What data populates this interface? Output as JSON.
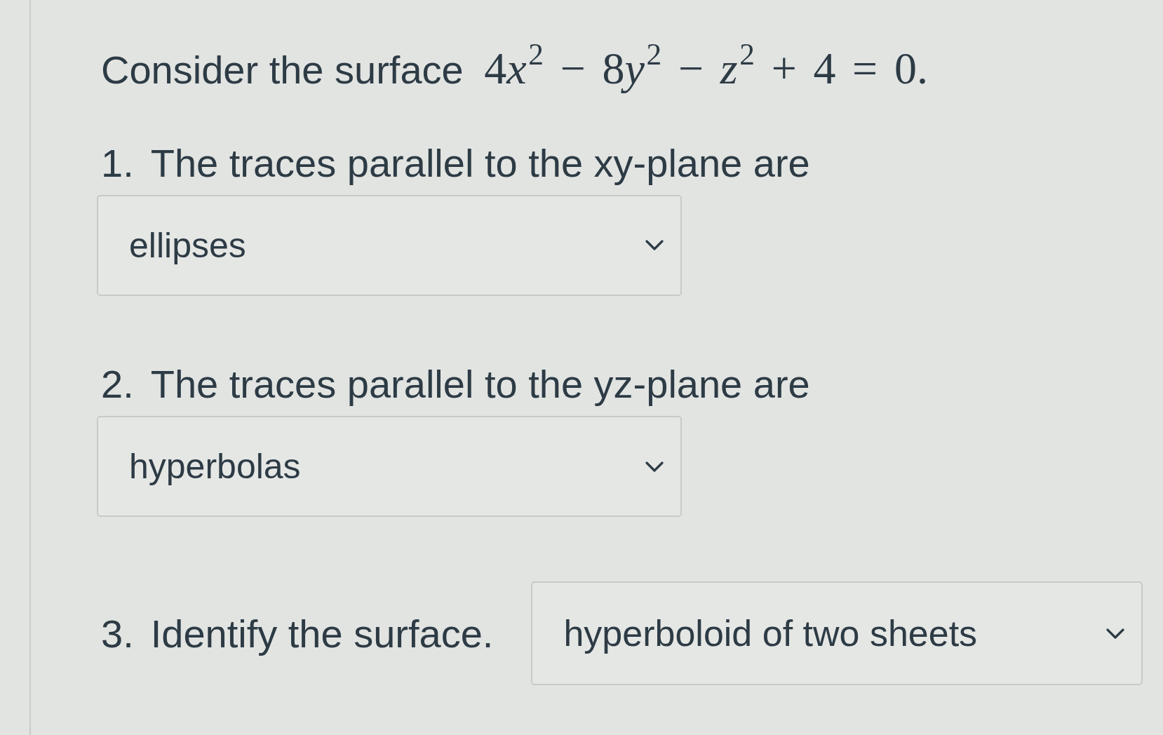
{
  "prompt": {
    "text": "Consider the surface",
    "equation": [
      {
        "kind": "number",
        "text": "4"
      },
      {
        "kind": "variable",
        "text": "x",
        "power": "2"
      },
      {
        "kind": "operator",
        "text": "−"
      },
      {
        "kind": "number",
        "text": "8"
      },
      {
        "kind": "variable",
        "text": "y",
        "power": "2"
      },
      {
        "kind": "operator",
        "text": "−"
      },
      {
        "kind": "variable",
        "text": "z",
        "power": "2"
      },
      {
        "kind": "operator",
        "text": "+"
      },
      {
        "kind": "number",
        "text": "4"
      },
      {
        "kind": "operator",
        "text": "="
      },
      {
        "kind": "number",
        "text": "0."
      }
    ]
  },
  "questions": [
    {
      "kind": "stacked",
      "number": "1.",
      "text": "The traces parallel to the xy-plane are",
      "answer": "ellipses"
    },
    {
      "kind": "stacked",
      "number": "2.",
      "text": "The traces parallel to the yz-plane are",
      "answer": "hyperbolas"
    },
    {
      "kind": "inline",
      "number": "3.",
      "text": "Identify the surface.",
      "answer": "hyperboloid of two sheets"
    }
  ]
}
